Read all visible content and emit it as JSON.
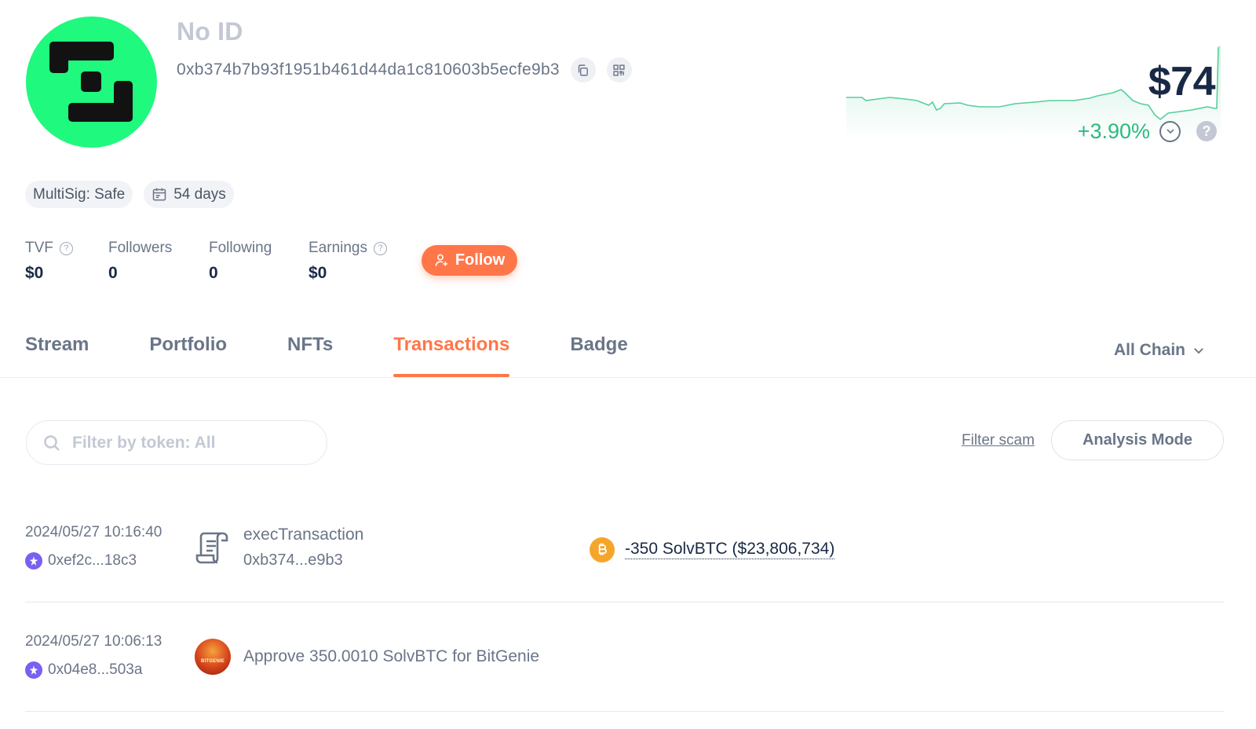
{
  "profile": {
    "name": "No ID",
    "address": "0xb374b7b93f1951b461d44da1c810603b5ecfe9b3"
  },
  "networth": {
    "value": "$74",
    "change": "+3.90%",
    "help": "?"
  },
  "tags": {
    "multisig": "MultiSig: Safe",
    "age": "54 days"
  },
  "stats": {
    "tvf_label": "TVF",
    "tvf_value": "$0",
    "followers_label": "Followers",
    "followers_value": "0",
    "following_label": "Following",
    "following_value": "0",
    "earnings_label": "Earnings",
    "earnings_value": "$0"
  },
  "follow_label": "Follow",
  "tabs": [
    {
      "label": "Stream"
    },
    {
      "label": "Portfolio"
    },
    {
      "label": "NFTs"
    },
    {
      "label": "Transactions"
    },
    {
      "label": "Badge"
    }
  ],
  "chain_filter": "All Chain",
  "search": {
    "placeholder": "Filter by token: All",
    "value": ""
  },
  "filter_scam_label": "Filter scam",
  "analysis_mode_label": "Analysis Mode",
  "transactions": [
    {
      "time": "2024/05/27 10:16:40",
      "hash": "0xef2c...18c3",
      "name": "execTransaction",
      "contract": "0xb374...e9b3",
      "token_change": "-350 SolvBTC ($23,806,734)"
    },
    {
      "time": "2024/05/27 10:06:13",
      "hash": "0x04e8...503a",
      "description": "Approve 350.0010 SolvBTC for BitGenie",
      "app_logo_text": "BITGENIE"
    }
  ],
  "colors": {
    "accent": "#ff7649",
    "positive": "#2abb7f",
    "avatar_bg": "#1ff97d",
    "chain": "#7b5ff1",
    "btc": "#f4a52a"
  },
  "icons": {
    "copy": "copy-icon",
    "qr": "qr-code-icon",
    "calendar": "calendar-icon",
    "user_add": "user-add-icon",
    "search": "search-icon",
    "contract": "contract-scroll-icon",
    "chevron": "chevron-down-icon"
  }
}
